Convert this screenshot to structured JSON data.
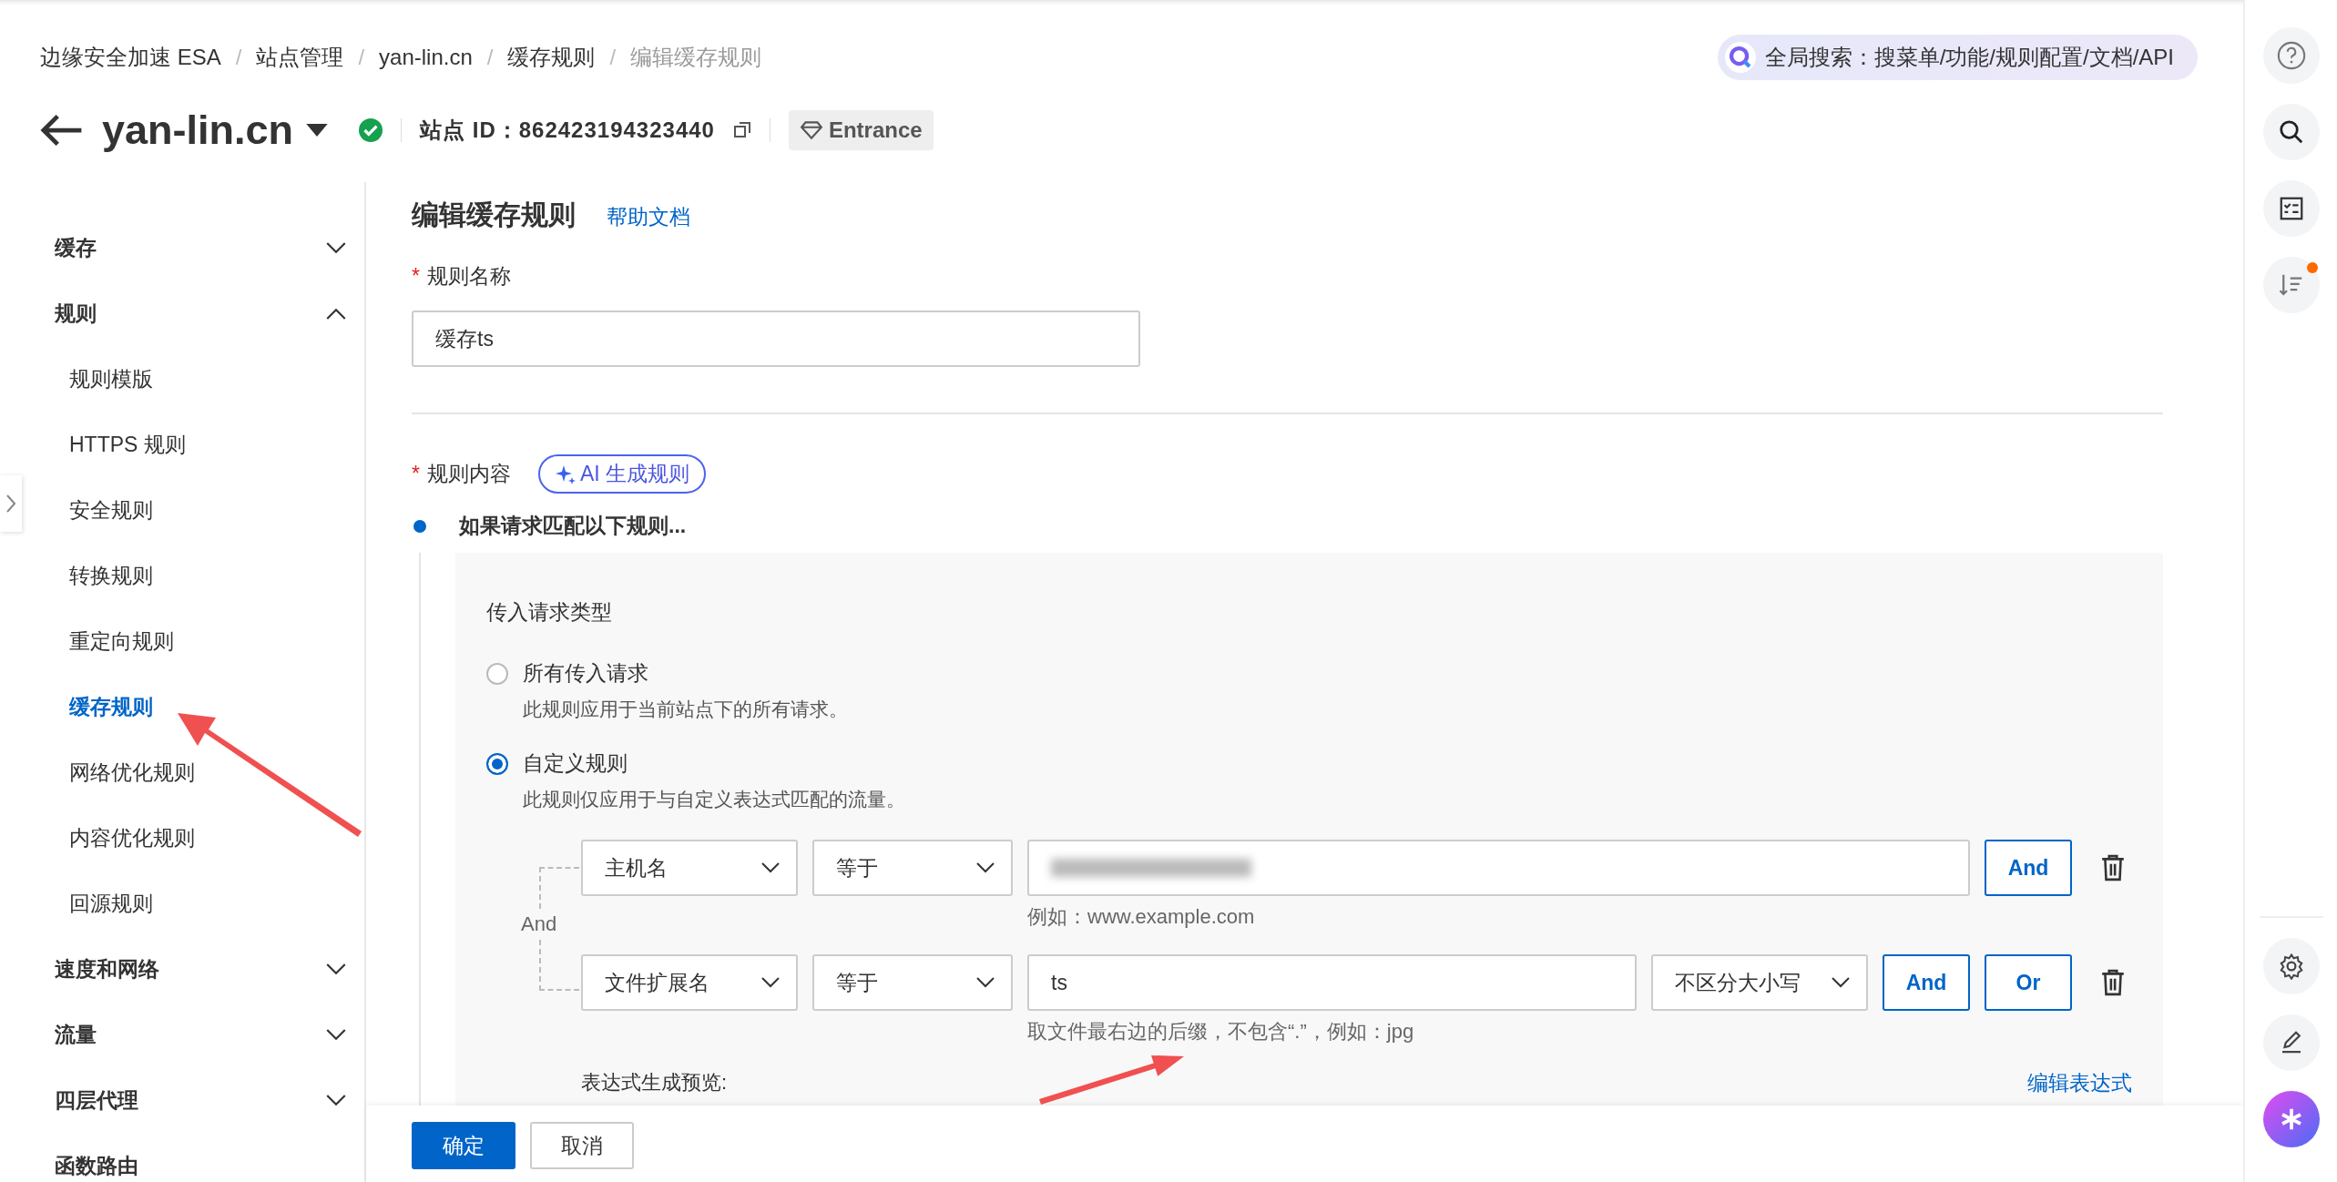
{
  "breadcrumbs": [
    {
      "label": "边缘安全加速 ESA",
      "current": false
    },
    {
      "separator": "/",
      "label": "站点管理",
      "current": false
    },
    {
      "separator": "/",
      "label": "yan-lin.cn",
      "current": false
    },
    {
      "separator": "/",
      "label": "缓存规则",
      "current": false
    },
    {
      "separator": "/",
      "label": "编辑缓存规则",
      "current": true
    }
  ],
  "header": {
    "site_name": "yan-lin.cn",
    "site_id_label": "站点 ID：",
    "site_id": "862423194323440",
    "entrance_button": "Entrance"
  },
  "global_search": {
    "text": "全局搜索：搜菜单/功能/规则配置/文档/API"
  },
  "sidebar": {
    "groups": [
      {
        "label": "缓存",
        "expanded": false
      },
      {
        "label": "规则",
        "expanded": true,
        "children": [
          {
            "label": "规则模版",
            "selected": false
          },
          {
            "label": "HTTPS 规则",
            "selected": false
          },
          {
            "label": "安全规则",
            "selected": false
          },
          {
            "label": "转换规则",
            "selected": false
          },
          {
            "label": "重定向规则",
            "selected": false
          },
          {
            "label": "缓存规则",
            "selected": true
          },
          {
            "label": "网络优化规则",
            "selected": false
          },
          {
            "label": "内容优化规则",
            "selected": false
          },
          {
            "label": "回源规则",
            "selected": false
          }
        ]
      },
      {
        "label": "速度和网络",
        "expanded": false
      },
      {
        "label": "流量",
        "expanded": false
      },
      {
        "label": "四层代理",
        "expanded": false
      },
      {
        "label": "函数路由"
      }
    ]
  },
  "form": {
    "title": "编辑缓存规则",
    "help_link": "帮助文档",
    "rule_name": {
      "label": "规则名称",
      "required_mark": "*",
      "value": "缓存ts"
    },
    "rule_content": {
      "label": "规则内容",
      "required_mark": "*",
      "ai_button": "AI 生成规则"
    },
    "step_title": "如果请求匹配以下规则...",
    "request_type": {
      "label": "传入请求类型",
      "options": [
        {
          "label": "所有传入请求",
          "description": "此规则应用于当前站点下的所有请求。",
          "selected": false
        },
        {
          "label": "自定义规则",
          "description": "此规则仅应用于与自定义表达式匹配的流量。",
          "selected": true
        }
      ]
    },
    "connector": "And",
    "conditions": [
      {
        "field": "主机名",
        "operator": "等于",
        "blurred": true,
        "hint": "例如：www.example.com",
        "buttons": [
          "And"
        ]
      },
      {
        "field": "文件扩展名",
        "operator": "等于",
        "value": "ts",
        "case_option": "不区分大小写",
        "hint": "取文件最右边的后缀，不包含“.”，例如：jpg",
        "buttons": [
          "And",
          "Or"
        ]
      }
    ],
    "preview_label": "表达式生成预览:",
    "edit_expression_link": "编辑表达式"
  },
  "footer_buttons": [
    {
      "label": "确定",
      "kind": "primary"
    },
    {
      "label": "取消",
      "kind": "default"
    }
  ]
}
